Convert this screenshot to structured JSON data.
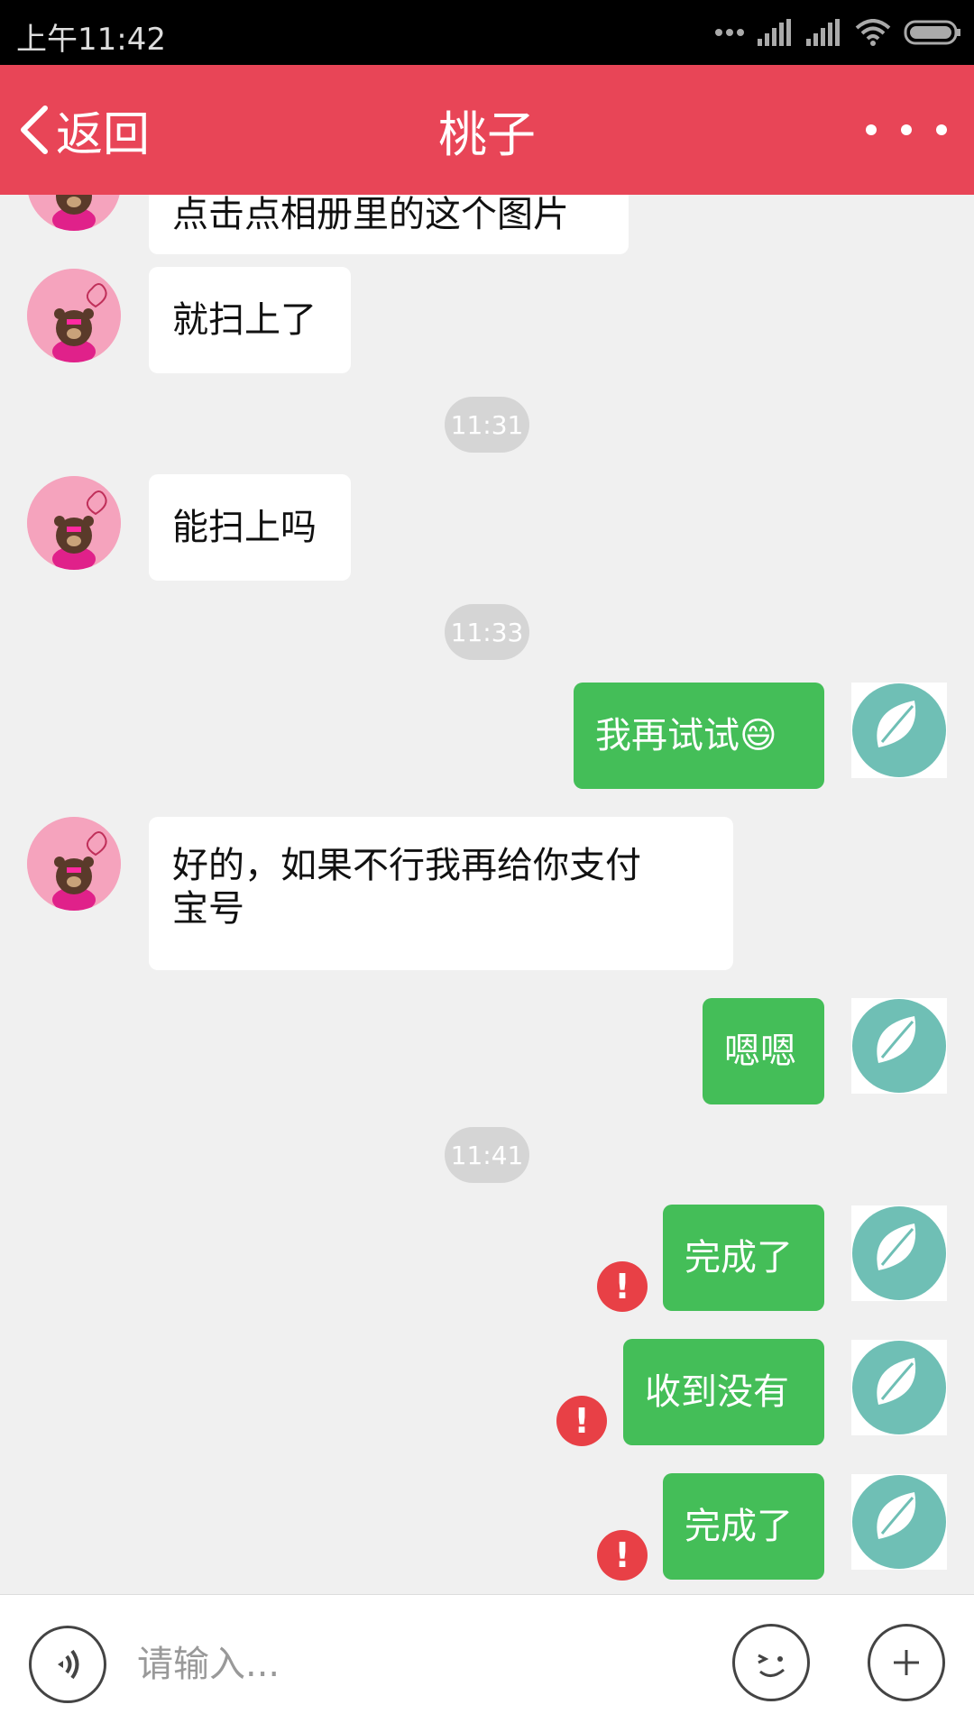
{
  "status_bar": {
    "time": "上午11:42"
  },
  "header": {
    "back_label": "返回",
    "title": "桃子"
  },
  "messages": [
    {
      "side": "in",
      "text": "点击点相册里的这个图片"
    },
    {
      "side": "in",
      "text": "就扫上了"
    },
    {
      "type": "timestamp",
      "text": "11:31"
    },
    {
      "side": "in",
      "text": "能扫上吗"
    },
    {
      "type": "timestamp",
      "text": "11:33"
    },
    {
      "side": "out",
      "text": "我再试试😄"
    },
    {
      "side": "in",
      "text_line1": "好的，如果不行我再给你支付",
      "text_line2": "宝号"
    },
    {
      "side": "out",
      "text": "嗯嗯"
    },
    {
      "type": "timestamp",
      "text": "11:41"
    },
    {
      "side": "out",
      "text": "完成了",
      "failed": true
    },
    {
      "side": "out",
      "text": "收到没有",
      "failed": true
    },
    {
      "side": "out",
      "text": "完成了",
      "failed": true
    }
  ],
  "error_mark": "!",
  "input_bar": {
    "placeholder": "请输入..."
  },
  "icons": {
    "back": "chevron-left-icon",
    "more": "more-dots-icon",
    "voice": "voice-icon",
    "emoji": "emoji-wink-icon",
    "add": "plus-icon"
  },
  "colors": {
    "header": "#e84557",
    "bubble_out": "#44be58",
    "error": "#e84046"
  }
}
